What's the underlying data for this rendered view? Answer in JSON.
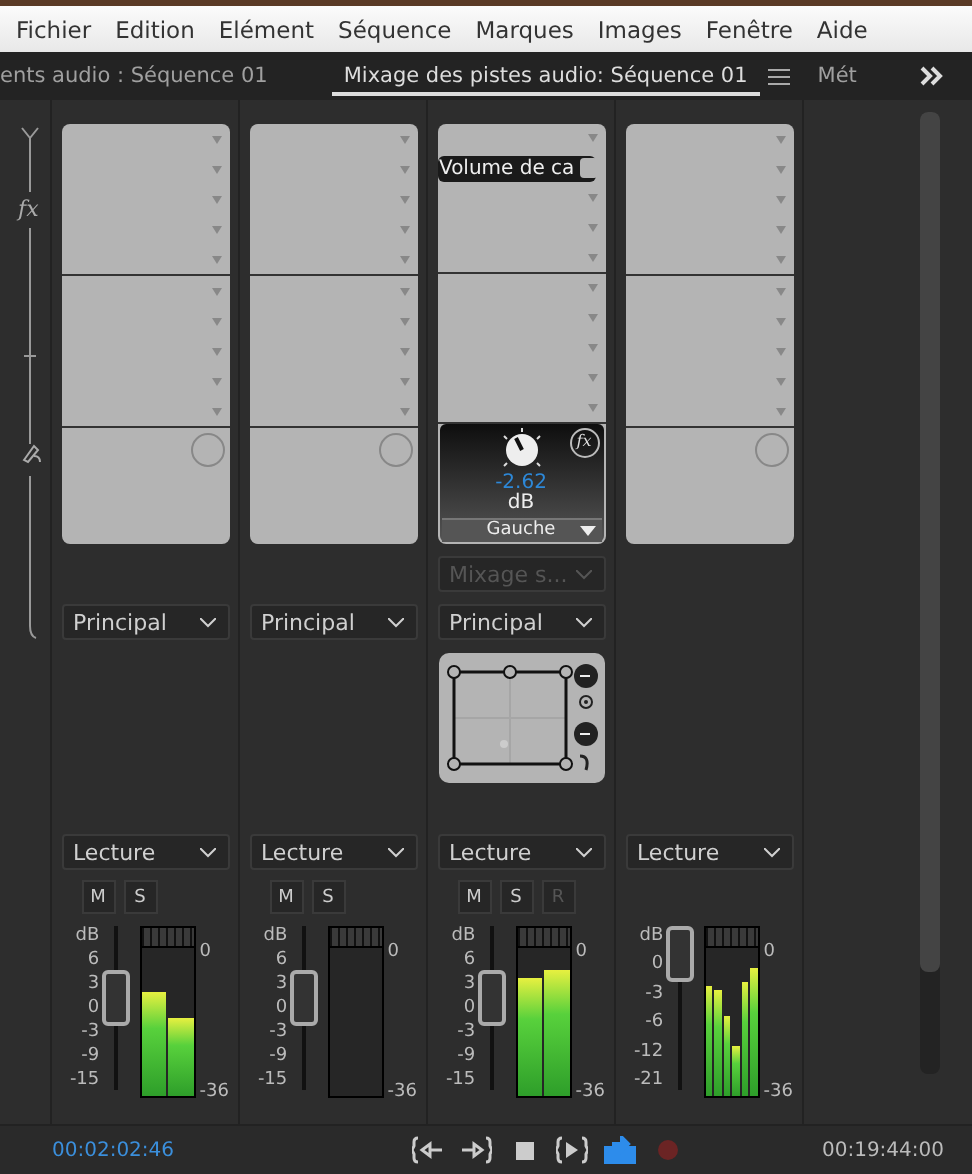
{
  "menu": [
    "Fichier",
    "Edition",
    "Elément",
    "Séquence",
    "Marques",
    "Images",
    "Fenêtre",
    "Aide"
  ],
  "tabs": [
    {
      "label": "ents audio : Séquence 01",
      "selected": false
    },
    {
      "label": "Mixage des pistes audio: Séquence 01",
      "selected": true
    },
    {
      "label": "Mét",
      "selected": false
    }
  ],
  "gutter": {
    "effects_marker": "fx"
  },
  "tracks": [
    {
      "output": "Principal",
      "mode": "Lecture",
      "buttons": [
        {
          "label": "M",
          "disabled": false
        },
        {
          "label": "S",
          "disabled": false
        }
      ],
      "fader_scale": [
        "dB",
        "6",
        "3",
        "0",
        "-3",
        "-9",
        "-15"
      ],
      "fader": {
        "level": 0.6
      },
      "meter_scale": [
        "0",
        "-36"
      ],
      "meter": [
        {
          "level": 0.62
        },
        {
          "level": 0.46
        }
      ]
    },
    {
      "output": "Principal",
      "mode": "Lecture",
      "buttons": [
        {
          "label": "M",
          "disabled": false
        },
        {
          "label": "S",
          "disabled": false
        }
      ],
      "fader_scale": [
        "dB",
        "6",
        "3",
        "0",
        "-3",
        "-9",
        "-15"
      ],
      "fader": {
        "level": 0.6
      },
      "meter_scale": [
        "0",
        "-36"
      ]
    },
    {
      "effect": "Volume de ca",
      "pan": {
        "fx": "fx",
        "value": "-2.62",
        "unit": "dB",
        "channel": "Gauche"
      },
      "send": {
        "label": "Mixage s...",
        "disabled": true
      },
      "output": "Principal",
      "panner": true,
      "mode": "Lecture",
      "buttons": [
        {
          "label": "M",
          "disabled": false
        },
        {
          "label": "S",
          "disabled": false
        },
        {
          "label": "R",
          "disabled": true
        }
      ],
      "fader_scale": [
        "dB",
        "6",
        "3",
        "0",
        "-3",
        "-9",
        "-15"
      ],
      "fader": {
        "level": 0.6
      },
      "meter_scale": [
        "0",
        "-36"
      ],
      "meter": [
        {
          "level": 0.7
        },
        {
          "level": 0.75
        }
      ]
    },
    {
      "mode": "Lecture",
      "fader_scale": [
        "dB",
        "0",
        "-3",
        "-6",
        "-12",
        "-21"
      ],
      "fader": {
        "level": 1
      },
      "meter_scale": [
        "0",
        "-36"
      ],
      "meter": [
        {
          "level": 0.66
        },
        {
          "level": 0.63
        },
        {
          "level": 0.48
        },
        {
          "level": 0.3
        },
        {
          "level": 0.68
        },
        {
          "level": 0.76
        }
      ]
    }
  ],
  "timecode_current": "00:02:02:46",
  "transport": [
    {
      "kind": "go-in",
      "on": false
    },
    {
      "kind": "go-out",
      "on": false
    },
    {
      "kind": "stop",
      "on": false
    },
    {
      "kind": "play-range",
      "on": false
    },
    {
      "kind": "loop",
      "on": true
    },
    {
      "kind": "record",
      "on": false
    }
  ],
  "timecode_duration": "00:19:44:00"
}
